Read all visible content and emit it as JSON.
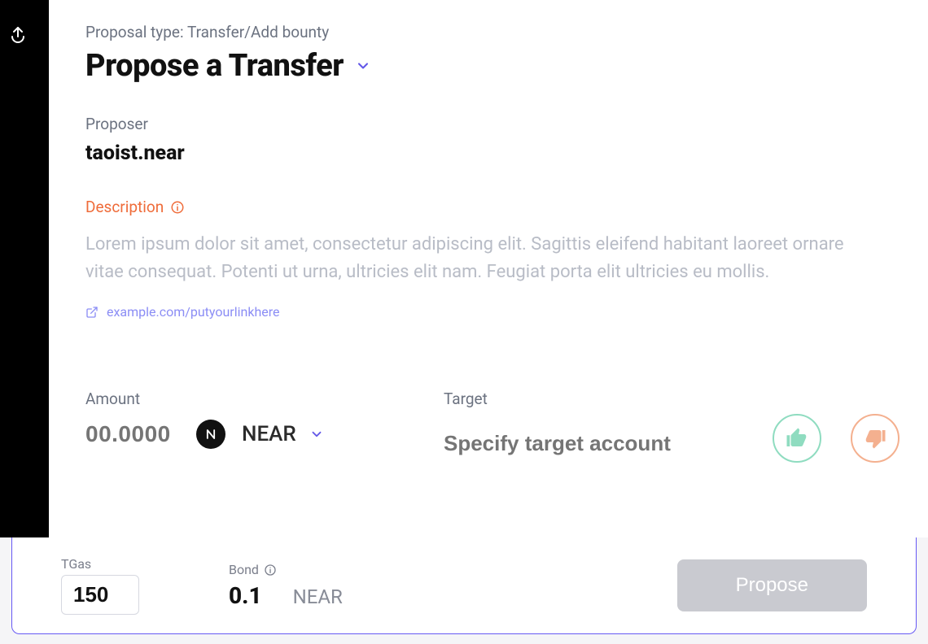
{
  "header": {
    "proposal_type_label": "Proposal type: Transfer/Add bounty",
    "title": "Propose a Transfer"
  },
  "proposer": {
    "label": "Proposer",
    "value": "taoist.near"
  },
  "description": {
    "label": "Description",
    "text": "Lorem ipsum dolor sit amet, consectetur adipiscing elit. Sagittis eleifend habitant laoreet ornare vitae consequat. Potenti ut urna, ultricies elit nam. Feugiat porta elit ultricies eu mollis."
  },
  "link": {
    "url_text": "example.com/putyourlinkhere"
  },
  "amount": {
    "label": "Amount",
    "placeholder": "00.0000",
    "token_label": "NEAR"
  },
  "target": {
    "label": "Target",
    "placeholder": "Specify target account"
  },
  "footer": {
    "tgas_label": "TGas",
    "tgas_value": "150",
    "bond_label": "Bond",
    "bond_value": "0.1",
    "bond_unit": "NEAR",
    "propose_label": "Propose"
  }
}
